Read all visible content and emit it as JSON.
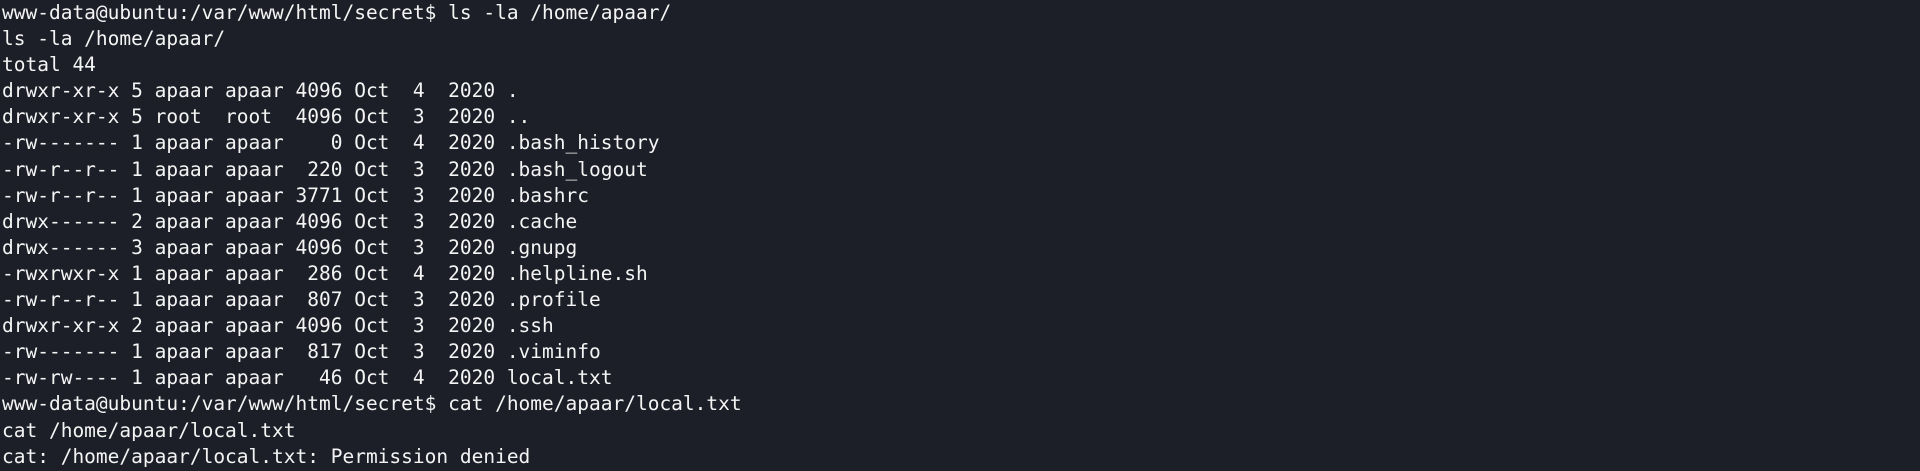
{
  "terminal": {
    "lines": [
      "www-data@ubuntu:/var/www/html/secret$ ls -la /home/apaar/",
      "ls -la /home/apaar/",
      "total 44",
      "drwxr-xr-x 5 apaar apaar 4096 Oct  4  2020 .",
      "drwxr-xr-x 5 root  root  4096 Oct  3  2020 ..",
      "-rw------- 1 apaar apaar    0 Oct  4  2020 .bash_history",
      "-rw-r--r-- 1 apaar apaar  220 Oct  3  2020 .bash_logout",
      "-rw-r--r-- 1 apaar apaar 3771 Oct  3  2020 .bashrc",
      "drwx------ 2 apaar apaar 4096 Oct  3  2020 .cache",
      "drwx------ 3 apaar apaar 4096 Oct  3  2020 .gnupg",
      "-rwxrwxr-x 1 apaar apaar  286 Oct  4  2020 .helpline.sh",
      "-rw-r--r-- 1 apaar apaar  807 Oct  3  2020 .profile",
      "drwxr-xr-x 2 apaar apaar 4096 Oct  3  2020 .ssh",
      "-rw------- 1 apaar apaar  817 Oct  3  2020 .viminfo",
      "-rw-rw---- 1 apaar apaar   46 Oct  4  2020 local.txt",
      "www-data@ubuntu:/var/www/html/secret$ cat /home/apaar/local.txt",
      "cat /home/apaar/local.txt",
      "cat: /home/apaar/local.txt: Permission denied"
    ]
  },
  "colors": {
    "background": "#1d1f28",
    "foreground": "#f4f4f4"
  }
}
